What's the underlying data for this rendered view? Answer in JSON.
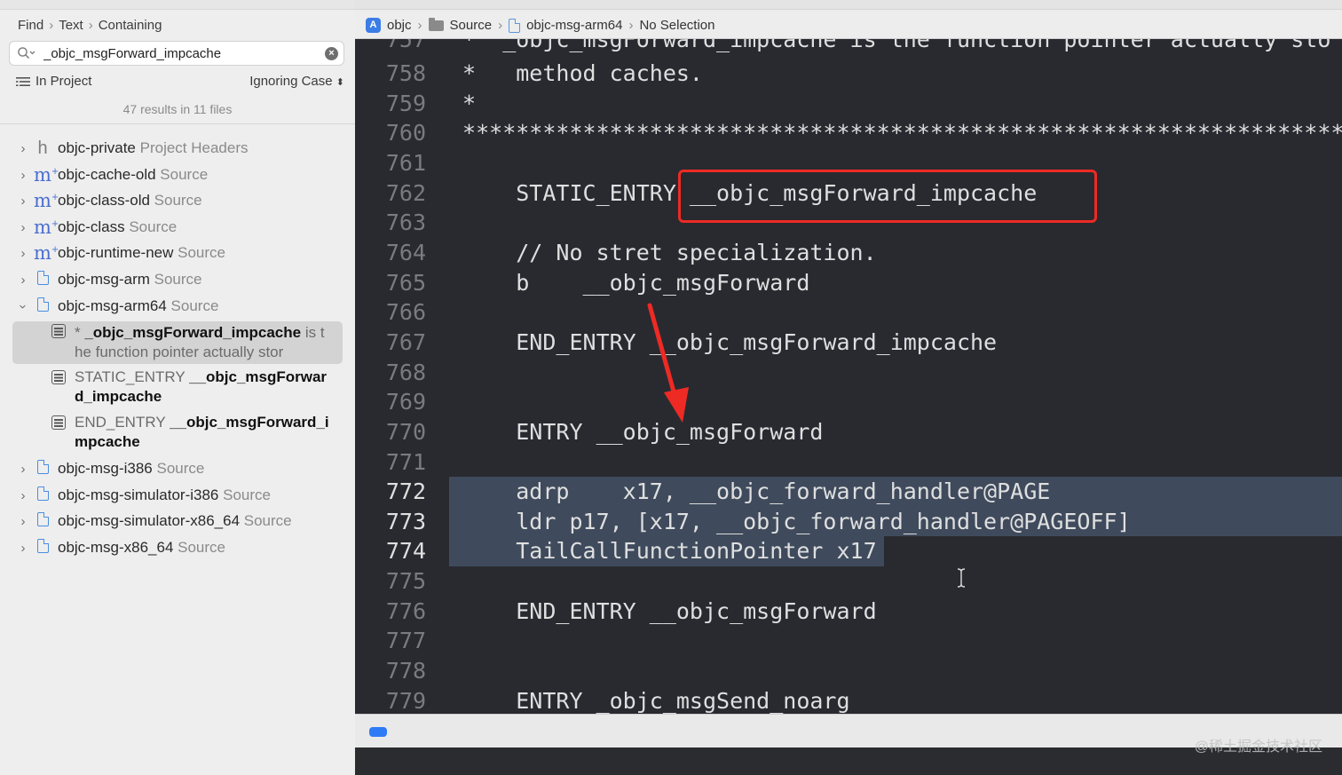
{
  "find_bar": {
    "crumbs": [
      "Find",
      "Text",
      "Containing"
    ],
    "search_value": "_objc_msgForward_impcache",
    "scope_label": "In Project",
    "case_label": "Ignoring Case",
    "results_summary": "47 results in 11 files"
  },
  "results_tree": {
    "files": [
      {
        "icon": "h",
        "name": "objc-private",
        "kind": "Project Headers"
      },
      {
        "icon": "m",
        "name": "objc-cache-old",
        "kind": "Source"
      },
      {
        "icon": "m",
        "name": "objc-class-old",
        "kind": "Source"
      },
      {
        "icon": "m",
        "name": "objc-class",
        "kind": "Source"
      },
      {
        "icon": "m",
        "name": "objc-runtime-new",
        "kind": "Source"
      },
      {
        "icon": "doc",
        "name": "objc-msg-arm",
        "kind": "Source"
      },
      {
        "icon": "doc",
        "name": "objc-msg-arm64",
        "kind": "Source"
      },
      {
        "icon": "doc",
        "name": "objc-msg-i386",
        "kind": "Source"
      },
      {
        "icon": "doc",
        "name": "objc-msg-simulator-i386",
        "kind": "Source"
      },
      {
        "icon": "doc",
        "name": "objc-msg-simulator-x86_64",
        "kind": "Source"
      },
      {
        "icon": "doc",
        "name": "objc-msg-x86_64",
        "kind": "Source"
      }
    ],
    "matches": [
      {
        "prefix": "* ",
        "match": "_objc_msgForward_impcache",
        "suffix": " is the function pointer actually stor"
      },
      {
        "prefix": "STATIC_ENTRY ",
        "match": "__objc_msgForward_impcache",
        "suffix": ""
      },
      {
        "prefix": "END_ENTRY ",
        "match": "__objc_msgForward_impcache",
        "suffix": ""
      }
    ]
  },
  "jump_bar": {
    "project": "objc",
    "group": "Source",
    "file": "objc-msg-arm64",
    "selection": "No Selection"
  },
  "editor": {
    "lines": [
      {
        "n": "757",
        "text": " *  _objc_msgForward_impcache is the function pointer actually sto",
        "style": "cmt"
      },
      {
        "n": "758",
        "text": " *   method caches.",
        "style": "cmt"
      },
      {
        "n": "759",
        "text": " *",
        "style": "cmt"
      },
      {
        "n": "760",
        "text": " ********************************************************************",
        "style": "cmt"
      },
      {
        "n": "761",
        "text": "",
        "style": "code"
      },
      {
        "n": "762",
        "text": "     STATIC_ENTRY __objc_msgForward_impcache",
        "style": "code"
      },
      {
        "n": "763",
        "text": "",
        "style": "code"
      },
      {
        "n": "764",
        "text": "     // No stret specialization.",
        "style": "cmt"
      },
      {
        "n": "765",
        "text": "     b    __objc_msgForward",
        "style": "code"
      },
      {
        "n": "766",
        "text": "",
        "style": "code"
      },
      {
        "n": "767",
        "text": "     END_ENTRY __objc_msgForward_impcache",
        "style": "code"
      },
      {
        "n": "768",
        "text": "",
        "style": "code"
      },
      {
        "n": "769",
        "text": "",
        "style": "code"
      },
      {
        "n": "770",
        "text": "     ENTRY __objc_msgForward",
        "style": "code"
      },
      {
        "n": "771",
        "text": "",
        "style": "code"
      },
      {
        "n": "772",
        "text": "     adrp    x17, __objc_forward_handler@PAGE",
        "style": "sel"
      },
      {
        "n": "773",
        "text": "     ldr p17, [x17, __objc_forward_handler@PAGEOFF]",
        "style": "sel"
      },
      {
        "n": "774",
        "text": "     TailCallFunctionPointer x17",
        "style": "sel"
      },
      {
        "n": "775",
        "text": "",
        "style": "code"
      },
      {
        "n": "776",
        "text": "     END_ENTRY __objc_msgForward",
        "style": "code"
      },
      {
        "n": "777",
        "text": "",
        "style": "code"
      },
      {
        "n": "778",
        "text": "",
        "style": "code"
      },
      {
        "n": "779",
        "text": "     ENTRY _objc_msgSend_noarg",
        "style": "code"
      }
    ]
  },
  "watermark": "@稀土掘金技术社区",
  "colors": {
    "comment": "#6bbf59",
    "annotation_red": "#ee2a24",
    "selection": "#3f4b5c",
    "editor_bg": "#292a30"
  }
}
